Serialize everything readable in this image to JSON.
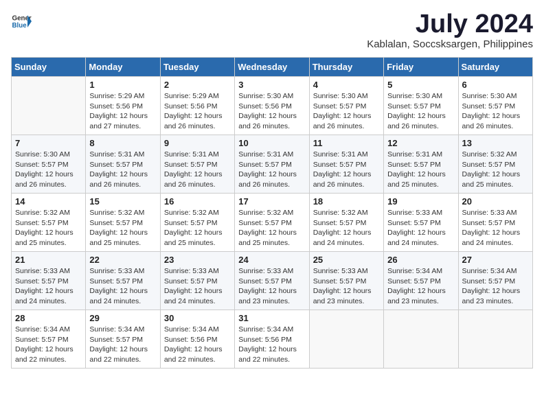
{
  "header": {
    "logo_general": "General",
    "logo_blue": "Blue",
    "title": "July 2024",
    "subtitle": "Kablalan, Soccsksargen, Philippines"
  },
  "calendar": {
    "days_of_week": [
      "Sunday",
      "Monday",
      "Tuesday",
      "Wednesday",
      "Thursday",
      "Friday",
      "Saturday"
    ],
    "weeks": [
      [
        {
          "day": "",
          "empty": true
        },
        {
          "day": "1",
          "sunrise": "Sunrise: 5:29 AM",
          "sunset": "Sunset: 5:56 PM",
          "daylight": "Daylight: 12 hours and 27 minutes."
        },
        {
          "day": "2",
          "sunrise": "Sunrise: 5:29 AM",
          "sunset": "Sunset: 5:56 PM",
          "daylight": "Daylight: 12 hours and 26 minutes."
        },
        {
          "day": "3",
          "sunrise": "Sunrise: 5:30 AM",
          "sunset": "Sunset: 5:56 PM",
          "daylight": "Daylight: 12 hours and 26 minutes."
        },
        {
          "day": "4",
          "sunrise": "Sunrise: 5:30 AM",
          "sunset": "Sunset: 5:57 PM",
          "daylight": "Daylight: 12 hours and 26 minutes."
        },
        {
          "day": "5",
          "sunrise": "Sunrise: 5:30 AM",
          "sunset": "Sunset: 5:57 PM",
          "daylight": "Daylight: 12 hours and 26 minutes."
        },
        {
          "day": "6",
          "sunrise": "Sunrise: 5:30 AM",
          "sunset": "Sunset: 5:57 PM",
          "daylight": "Daylight: 12 hours and 26 minutes."
        }
      ],
      [
        {
          "day": "7",
          "sunrise": "Sunrise: 5:30 AM",
          "sunset": "Sunset: 5:57 PM",
          "daylight": "Daylight: 12 hours and 26 minutes."
        },
        {
          "day": "8",
          "sunrise": "Sunrise: 5:31 AM",
          "sunset": "Sunset: 5:57 PM",
          "daylight": "Daylight: 12 hours and 26 minutes."
        },
        {
          "day": "9",
          "sunrise": "Sunrise: 5:31 AM",
          "sunset": "Sunset: 5:57 PM",
          "daylight": "Daylight: 12 hours and 26 minutes."
        },
        {
          "day": "10",
          "sunrise": "Sunrise: 5:31 AM",
          "sunset": "Sunset: 5:57 PM",
          "daylight": "Daylight: 12 hours and 26 minutes."
        },
        {
          "day": "11",
          "sunrise": "Sunrise: 5:31 AM",
          "sunset": "Sunset: 5:57 PM",
          "daylight": "Daylight: 12 hours and 26 minutes."
        },
        {
          "day": "12",
          "sunrise": "Sunrise: 5:31 AM",
          "sunset": "Sunset: 5:57 PM",
          "daylight": "Daylight: 12 hours and 25 minutes."
        },
        {
          "day": "13",
          "sunrise": "Sunrise: 5:32 AM",
          "sunset": "Sunset: 5:57 PM",
          "daylight": "Daylight: 12 hours and 25 minutes."
        }
      ],
      [
        {
          "day": "14",
          "sunrise": "Sunrise: 5:32 AM",
          "sunset": "Sunset: 5:57 PM",
          "daylight": "Daylight: 12 hours and 25 minutes."
        },
        {
          "day": "15",
          "sunrise": "Sunrise: 5:32 AM",
          "sunset": "Sunset: 5:57 PM",
          "daylight": "Daylight: 12 hours and 25 minutes."
        },
        {
          "day": "16",
          "sunrise": "Sunrise: 5:32 AM",
          "sunset": "Sunset: 5:57 PM",
          "daylight": "Daylight: 12 hours and 25 minutes."
        },
        {
          "day": "17",
          "sunrise": "Sunrise: 5:32 AM",
          "sunset": "Sunset: 5:57 PM",
          "daylight": "Daylight: 12 hours and 25 minutes."
        },
        {
          "day": "18",
          "sunrise": "Sunrise: 5:32 AM",
          "sunset": "Sunset: 5:57 PM",
          "daylight": "Daylight: 12 hours and 24 minutes."
        },
        {
          "day": "19",
          "sunrise": "Sunrise: 5:33 AM",
          "sunset": "Sunset: 5:57 PM",
          "daylight": "Daylight: 12 hours and 24 minutes."
        },
        {
          "day": "20",
          "sunrise": "Sunrise: 5:33 AM",
          "sunset": "Sunset: 5:57 PM",
          "daylight": "Daylight: 12 hours and 24 minutes."
        }
      ],
      [
        {
          "day": "21",
          "sunrise": "Sunrise: 5:33 AM",
          "sunset": "Sunset: 5:57 PM",
          "daylight": "Daylight: 12 hours and 24 minutes."
        },
        {
          "day": "22",
          "sunrise": "Sunrise: 5:33 AM",
          "sunset": "Sunset: 5:57 PM",
          "daylight": "Daylight: 12 hours and 24 minutes."
        },
        {
          "day": "23",
          "sunrise": "Sunrise: 5:33 AM",
          "sunset": "Sunset: 5:57 PM",
          "daylight": "Daylight: 12 hours and 24 minutes."
        },
        {
          "day": "24",
          "sunrise": "Sunrise: 5:33 AM",
          "sunset": "Sunset: 5:57 PM",
          "daylight": "Daylight: 12 hours and 23 minutes."
        },
        {
          "day": "25",
          "sunrise": "Sunrise: 5:33 AM",
          "sunset": "Sunset: 5:57 PM",
          "daylight": "Daylight: 12 hours and 23 minutes."
        },
        {
          "day": "26",
          "sunrise": "Sunrise: 5:34 AM",
          "sunset": "Sunset: 5:57 PM",
          "daylight": "Daylight: 12 hours and 23 minutes."
        },
        {
          "day": "27",
          "sunrise": "Sunrise: 5:34 AM",
          "sunset": "Sunset: 5:57 PM",
          "daylight": "Daylight: 12 hours and 23 minutes."
        }
      ],
      [
        {
          "day": "28",
          "sunrise": "Sunrise: 5:34 AM",
          "sunset": "Sunset: 5:57 PM",
          "daylight": "Daylight: 12 hours and 22 minutes."
        },
        {
          "day": "29",
          "sunrise": "Sunrise: 5:34 AM",
          "sunset": "Sunset: 5:57 PM",
          "daylight": "Daylight: 12 hours and 22 minutes."
        },
        {
          "day": "30",
          "sunrise": "Sunrise: 5:34 AM",
          "sunset": "Sunset: 5:56 PM",
          "daylight": "Daylight: 12 hours and 22 minutes."
        },
        {
          "day": "31",
          "sunrise": "Sunrise: 5:34 AM",
          "sunset": "Sunset: 5:56 PM",
          "daylight": "Daylight: 12 hours and 22 minutes."
        },
        {
          "day": "",
          "empty": true
        },
        {
          "day": "",
          "empty": true
        },
        {
          "day": "",
          "empty": true
        }
      ]
    ]
  }
}
